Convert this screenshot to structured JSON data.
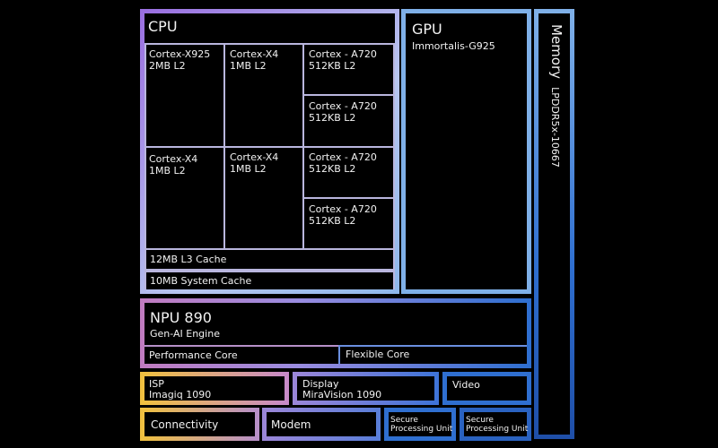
{
  "cpu": {
    "title": "CPU",
    "cores": [
      {
        "name": "Cortex-X925",
        "cache": "2MB L2"
      },
      {
        "name": "Cortex-X4",
        "cache": "1MB L2"
      },
      {
        "name": "Cortex - A720",
        "cache": "512KB L2"
      },
      {
        "name": "Cortex - A720",
        "cache": "512KB L2"
      },
      {
        "name": "Cortex-X4",
        "cache": "1MB L2"
      },
      {
        "name": "Cortex-X4",
        "cache": "1MB L2"
      },
      {
        "name": "Cortex - A720",
        "cache": "512KB L2"
      },
      {
        "name": "Cortex - A720",
        "cache": "512KB L2"
      }
    ],
    "l3": "12MB L3 Cache",
    "system_cache": "10MB System Cache"
  },
  "gpu": {
    "title": "GPU",
    "model": "Immortalis-G925"
  },
  "memory": {
    "title": "Memory",
    "type": "LPDDR5x-10667"
  },
  "npu": {
    "title": "NPU 890",
    "subtitle": "Gen-AI Engine",
    "performance": "Performance Core",
    "flexible": "Flexible Core"
  },
  "isp": {
    "title": "ISP",
    "model": "Imagiq 1090"
  },
  "display": {
    "title": "Display",
    "model": "MiraVision 1090"
  },
  "video": {
    "title": "Video"
  },
  "connectivity": "Connectivity",
  "modem": "Modem",
  "spu": [
    "Secure\nProcessing Unit",
    "Secure\nProcessing Unit"
  ],
  "colors": {
    "purple": "#9a6fe0",
    "light_blue": "#7fb0e8",
    "blue": "#2f6fd0",
    "yellow": "#f0c040"
  }
}
